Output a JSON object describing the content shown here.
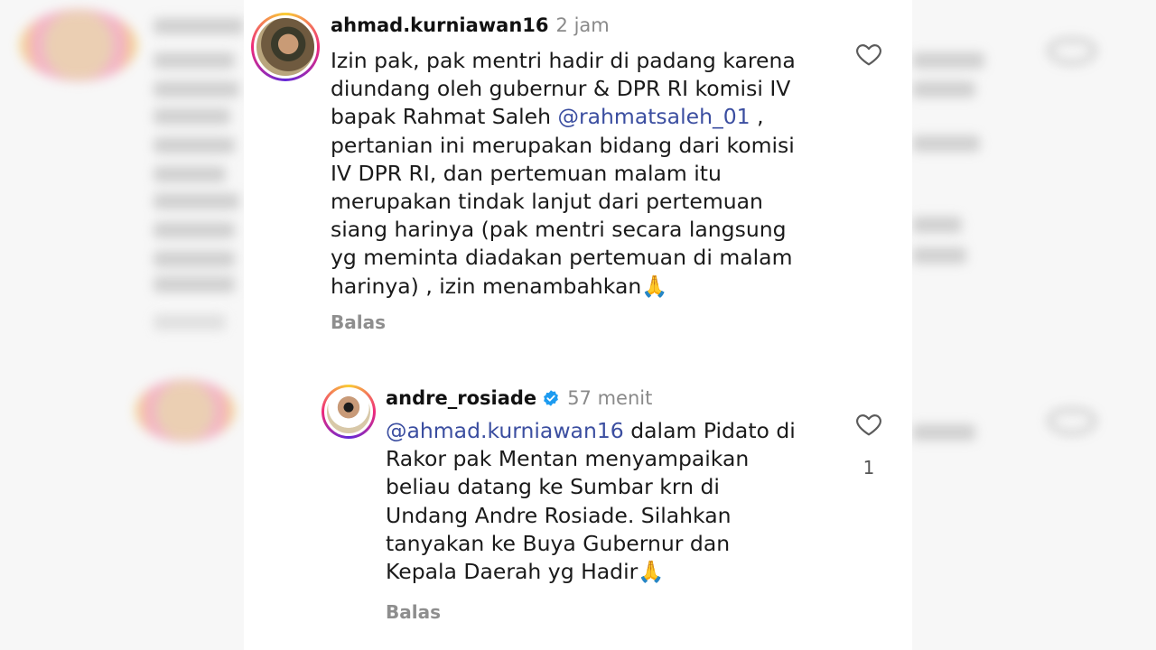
{
  "comments": [
    {
      "username": "ahmad.kurniawan16",
      "time": "2 jam",
      "text_lines": [
        "Izin pak, pak mentri hadir di padang karena",
        "diundang oleh gubernur & DPR RI komisi IV",
        "bapak Rahmat Saleh ",
        "pertanian ini merupakan bidang dari komisi",
        "IV DPR RI, dan pertemuan malam itu",
        "merupakan tindak lanjut dari pertemuan",
        "siang harinya (pak mentri secara langsung",
        "yg meminta diadakan pertemuan di malam",
        "harinya) , izin menambahkan🙏"
      ],
      "mention": "@rahmatsaleh_01",
      "mention_suffix": " ,",
      "reply_label": "Balas",
      "like_icon": "heart-outline-icon"
    },
    {
      "username": "andre_rosiade",
      "verified": true,
      "time": "57 menit",
      "mention": "@ahmad.kurniawan16",
      "text_lines": [
        " dalam Pidato di",
        "Rakor pak Mentan menyampaikan",
        "beliau datang ke Sumbar krn di",
        "Undang Andre Rosiade. Silahkan",
        "tanyakan ke Buya Gubernur dan",
        "Kepala Daerah yg Hadir🙏"
      ],
      "reply_label": "Balas",
      "like_icon": "heart-outline-icon",
      "like_count": "1"
    }
  ],
  "colors": {
    "mention": "#3b4ea0",
    "verified": "#1d9bf0",
    "muted": "#8e8e8e"
  }
}
